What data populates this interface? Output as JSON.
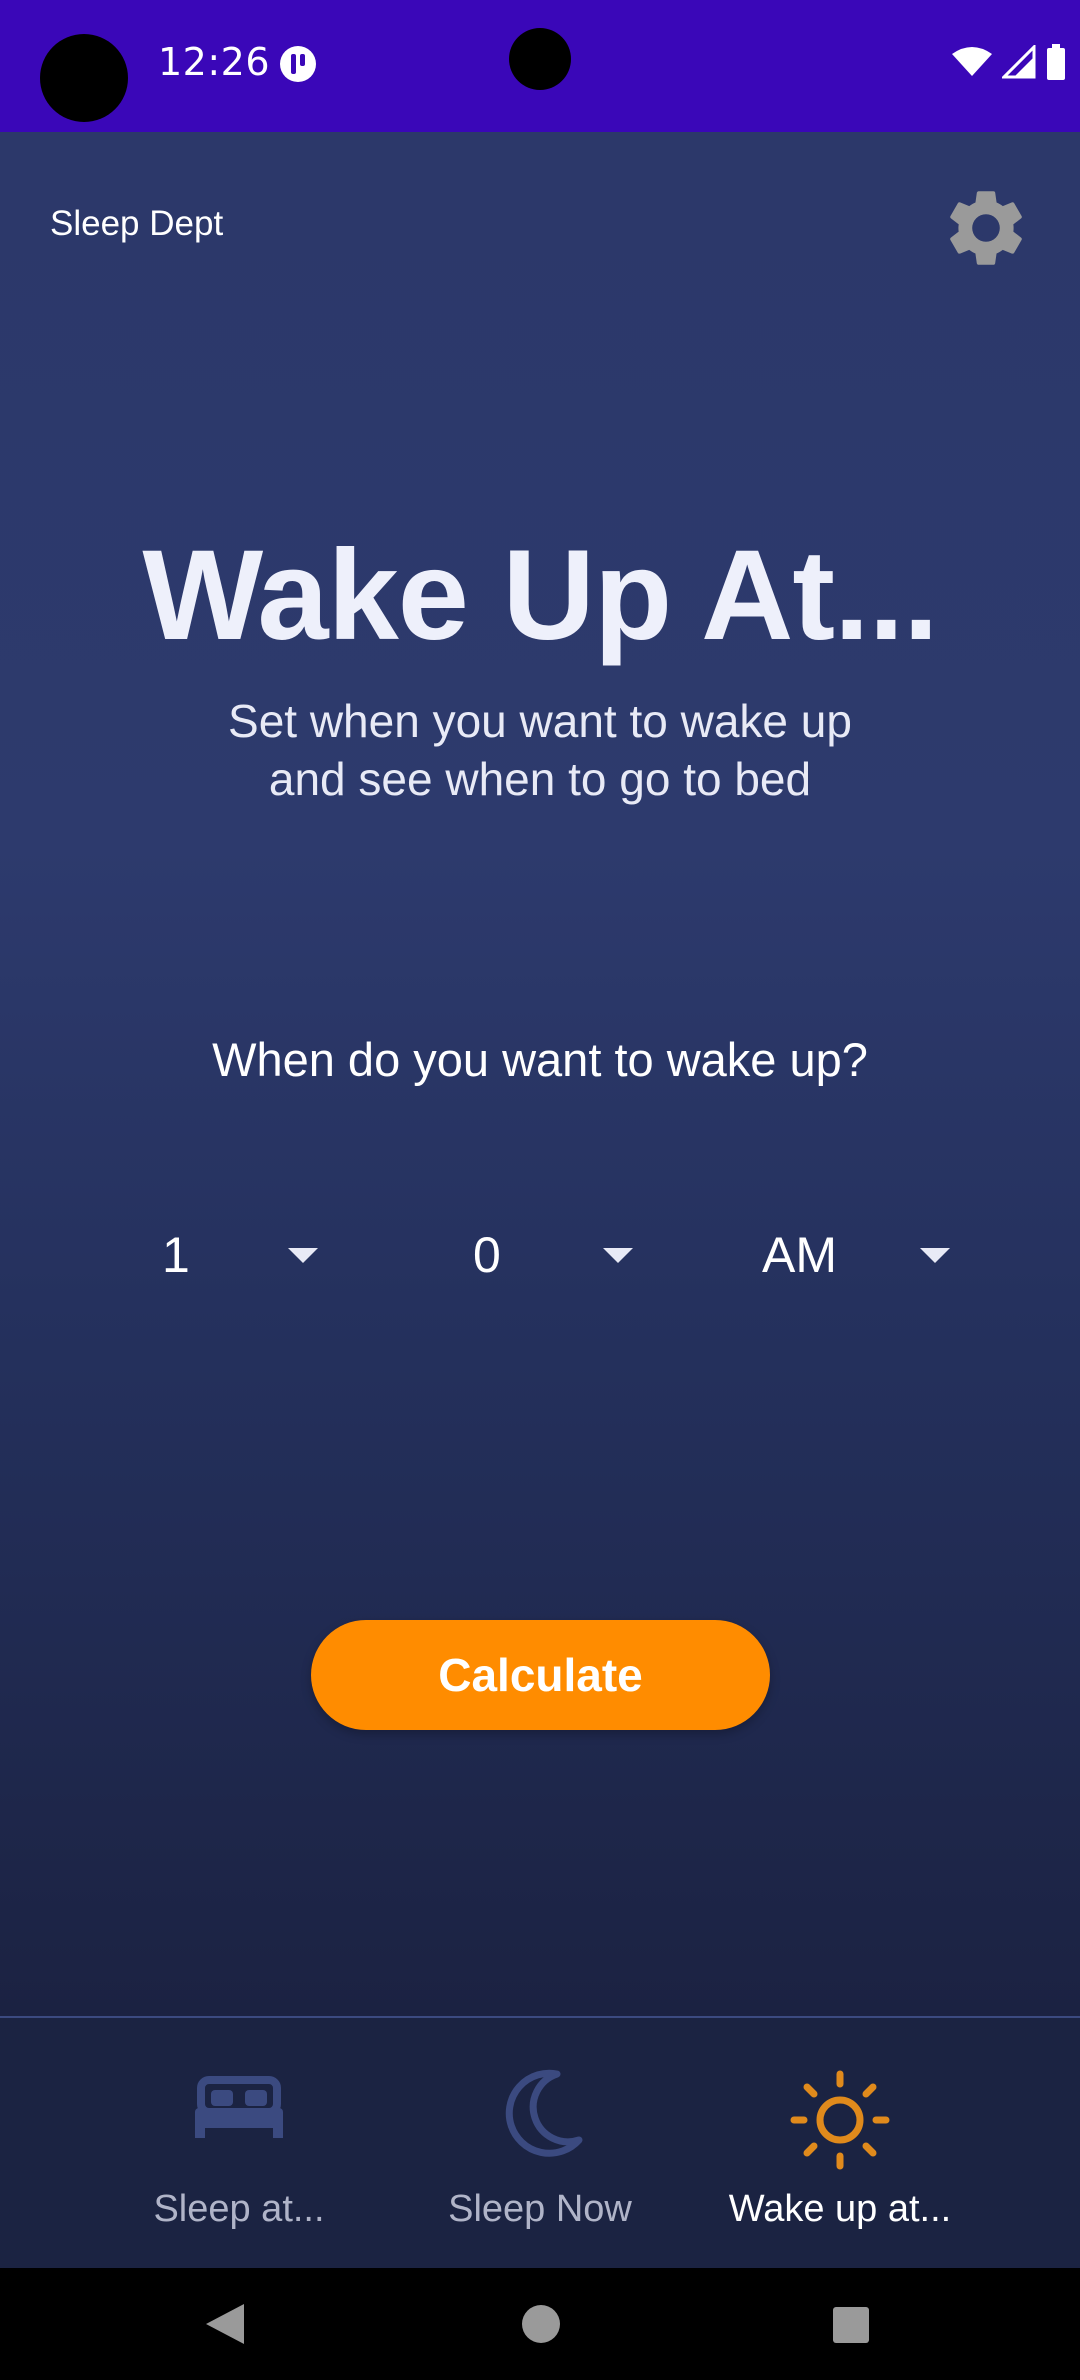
{
  "status_bar": {
    "time": "12:26"
  },
  "header": {
    "app_name": "Sleep Dept"
  },
  "main": {
    "title": "Wake Up At...",
    "subtitle_line1": "Set when you want to wake up",
    "subtitle_line2": "and see when to go to bed",
    "question": "When do you want to wake up?",
    "pickers": {
      "hour": "1",
      "minute": "0",
      "period": "AM"
    },
    "calculate_label": "Calculate"
  },
  "bottom_nav": {
    "items": [
      {
        "label": "Sleep at...",
        "icon": "bed-icon",
        "active": false
      },
      {
        "label": "Sleep Now",
        "icon": "moon-icon",
        "active": false
      },
      {
        "label": "Wake up at...",
        "icon": "sun-icon",
        "active": true
      }
    ]
  },
  "colors": {
    "status_bar": "#3a07b8",
    "background": "#2c386a",
    "accent": "#ff8c00",
    "inactive_icon": "#3b4a80",
    "active_icon": "#e08a1c"
  }
}
